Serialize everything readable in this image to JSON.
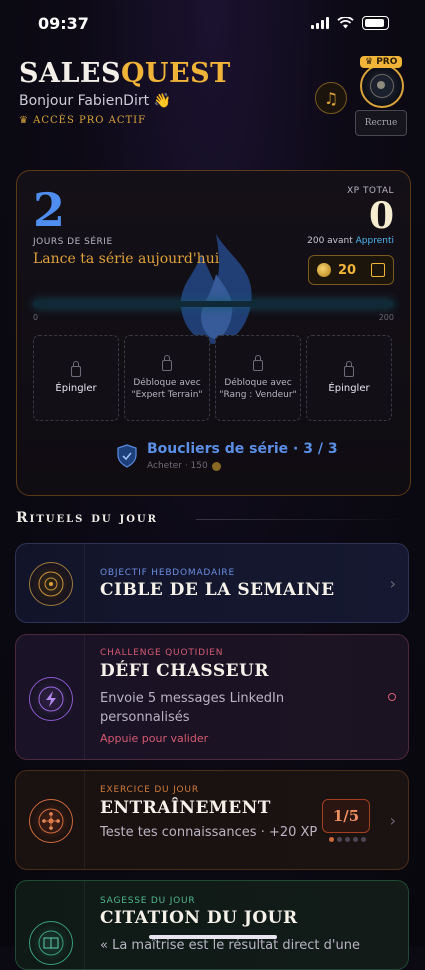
{
  "status_bar": {
    "time": "09:37"
  },
  "header": {
    "brand_part1": "SALES",
    "brand_part2": "QUEST",
    "greeting": "Bonjour FabienDirt 👋",
    "pro_access": "♛ ACCÈS PRO ACTIF",
    "music_icon": "♫",
    "pro_badge": "♛ PRO",
    "rank_button": "Recrue"
  },
  "streak_card": {
    "streak_days": "2",
    "streak_label": "JOURS DE SÉRIE",
    "streak_cta": "Lance ta série aujourd'hui",
    "xp_label": "XP TOTAL",
    "xp_total": "0",
    "xp_before_prefix": "200 avant",
    "xp_before_rank": "Apprenti",
    "coins": "20",
    "progress": {
      "value": 0,
      "max": 200,
      "min_label": "0",
      "max_label": "200"
    },
    "slots": [
      {
        "text": "Épingler",
        "locked": false
      },
      {
        "text": "Débloque avec \"Expert Terrain\"",
        "locked": true
      },
      {
        "text": "Débloque avec \"Rang : Vendeur\"",
        "locked": true
      },
      {
        "text": "Épingler",
        "locked": false
      }
    ],
    "shields_title": "Boucliers de série · 3 / 3",
    "shields_buy": "Acheter · 150"
  },
  "rituals_section": {
    "title": "Rituels du jour",
    "items": [
      {
        "eyebrow": "OBJECTIF HEBDOMADAIRE",
        "title": "CIBLE DE LA SEMAINE"
      },
      {
        "eyebrow": "CHALLENGE QUOTIDIEN",
        "title": "DÉFI CHASSEUR",
        "desc": "Envoie 5 messages LinkedIn personnalisés",
        "hint": "Appuie pour valider"
      },
      {
        "eyebrow": "EXERCICE DU JOUR",
        "title": "ENTRAÎNEMENT",
        "desc": "Teste tes connaissances · +20 XP",
        "score": "1/5"
      },
      {
        "eyebrow": "SAGESSE DU JOUR",
        "title": "CITATION DU JOUR",
        "desc": "« La maîtrise est le résultat direct d'une"
      }
    ]
  },
  "colors": {
    "gold": "#f0b438",
    "blue": "#4f8ef0",
    "cyan": "#39b1d8",
    "red": "#d65a72",
    "orange": "#d07a3a",
    "green": "#4fb890"
  },
  "icons": [
    "signal-icon",
    "wifi-icon",
    "battery-icon",
    "music-icon",
    "crown-icon",
    "lock-icon",
    "coin-icon",
    "cart-icon",
    "shield-icon",
    "target-icon",
    "lightning-icon",
    "network-icon",
    "book-icon",
    "chevron-right-icon",
    "flame-icon"
  ]
}
